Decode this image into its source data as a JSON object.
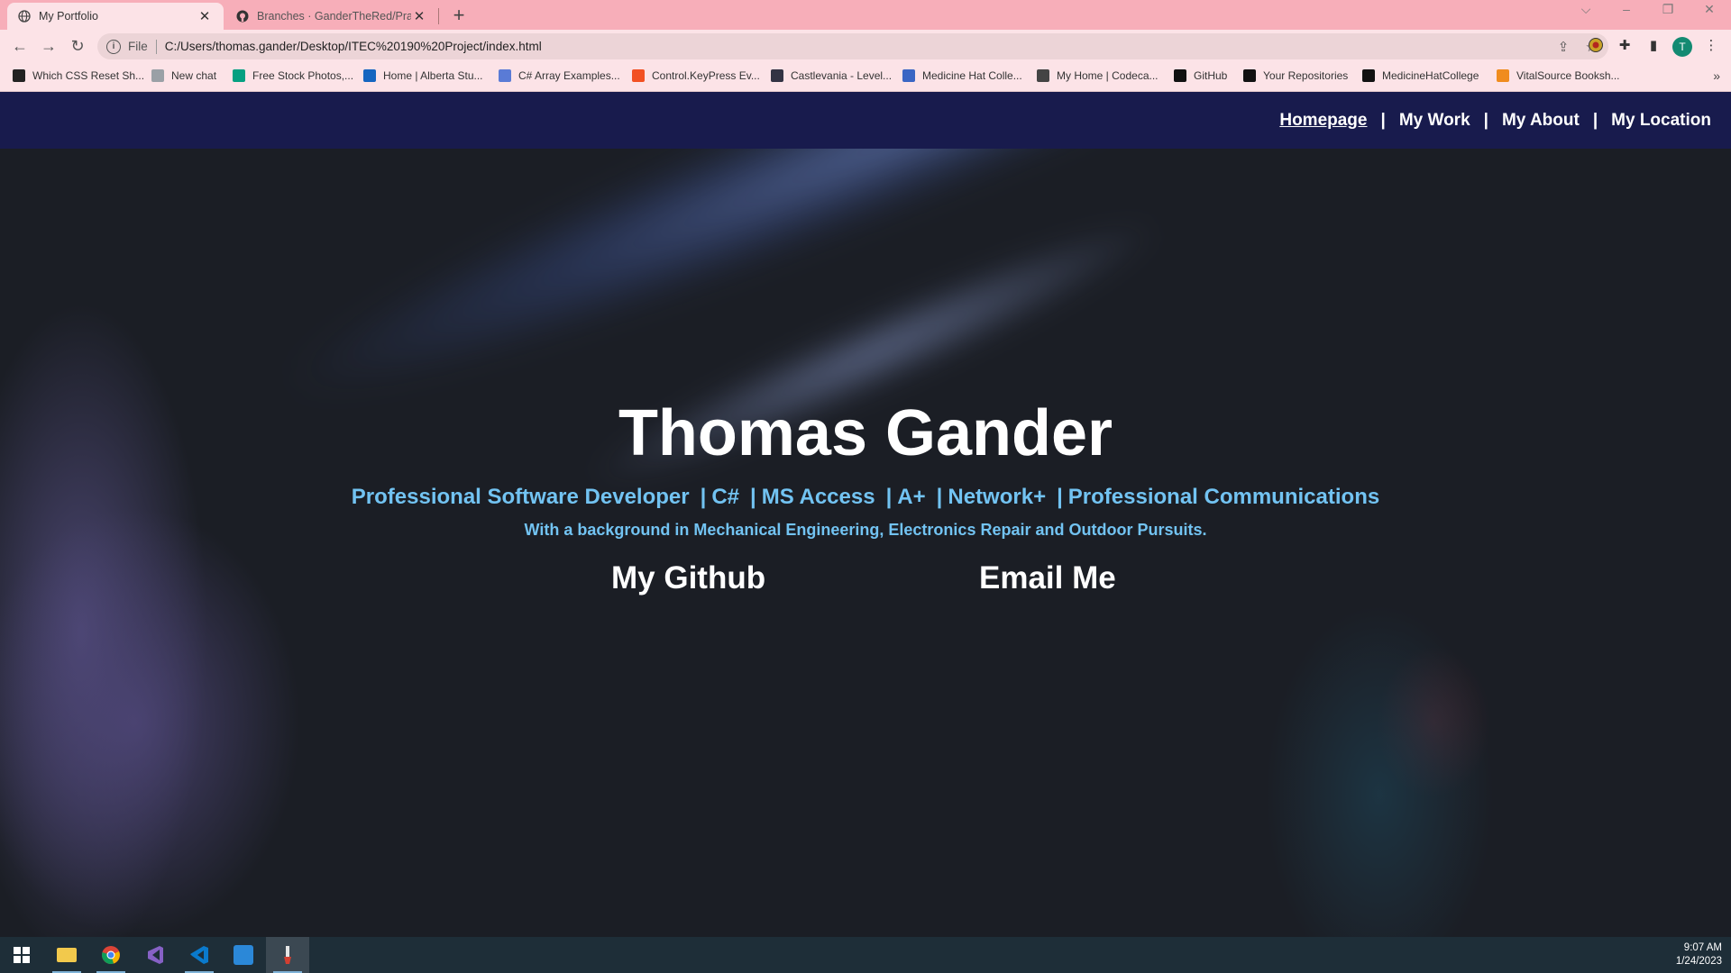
{
  "browser": {
    "tabs": [
      {
        "title": "My Portfolio",
        "active": true
      },
      {
        "title": "Branches · GanderTheRed/Practic",
        "active": false
      }
    ],
    "window_controls": {
      "dropdown": "⌵",
      "minimize": "–",
      "restore": "❐",
      "close": "✕"
    },
    "address": {
      "scheme_label": "File",
      "url": "C:/Users/thomas.gander/Desktop/ITEC%20190%20Project/index.html"
    },
    "bookmarks": [
      {
        "label": "Which CSS Reset Sh...",
        "color": "#222222"
      },
      {
        "label": "New chat",
        "color": "#9aa0a6"
      },
      {
        "label": "Free Stock Photos,...",
        "color": "#05a081"
      },
      {
        "label": "Home | Alberta Stu...",
        "color": "#1565c0"
      },
      {
        "label": "C# Array Examples...",
        "color": "#5a7bd6"
      },
      {
        "label": "Control.KeyPress Ev...",
        "color": "#f25022"
      },
      {
        "label": "Castlevania - Level...",
        "color": "#334"
      },
      {
        "label": "Medicine Hat Colle...",
        "color": "#3a66c4"
      },
      {
        "label": "My Home | Codeca...",
        "color": "#444444"
      },
      {
        "label": "GitHub",
        "color": "#111111"
      },
      {
        "label": "Your Repositories",
        "color": "#111111"
      },
      {
        "label": "MedicineHatCollege",
        "color": "#111111"
      },
      {
        "label": "VitalSource Booksh...",
        "color": "#f08c1e"
      }
    ],
    "bookmarks_overflow": "»",
    "profile_initial": "T"
  },
  "site": {
    "nav": [
      {
        "label": "Homepage",
        "current": true
      },
      {
        "label": "My Work",
        "current": false
      },
      {
        "label": "My About",
        "current": false
      },
      {
        "label": "My Location",
        "current": false
      }
    ],
    "nav_separator": "|",
    "hero": {
      "name": "Thomas Gander",
      "skills": [
        "Professional Software Developer",
        "C#",
        "MS Access",
        "A+",
        "Network+",
        "Professional Communications"
      ],
      "skills_separator": "|",
      "tagline": "With a background in Mechanical Engineering, Electronics Repair and Outdoor Pursuits.",
      "github_link": "My Github",
      "email_link": "Email Me"
    },
    "colors": {
      "navbar": "#181b4d",
      "accent": "#72c3f2"
    }
  },
  "taskbar": {
    "apps": [
      "windows-start",
      "file-explorer",
      "chrome",
      "visual-studio",
      "vs-code",
      "store",
      "paint"
    ],
    "time": "9:07 AM",
    "date": "1/24/2023"
  }
}
